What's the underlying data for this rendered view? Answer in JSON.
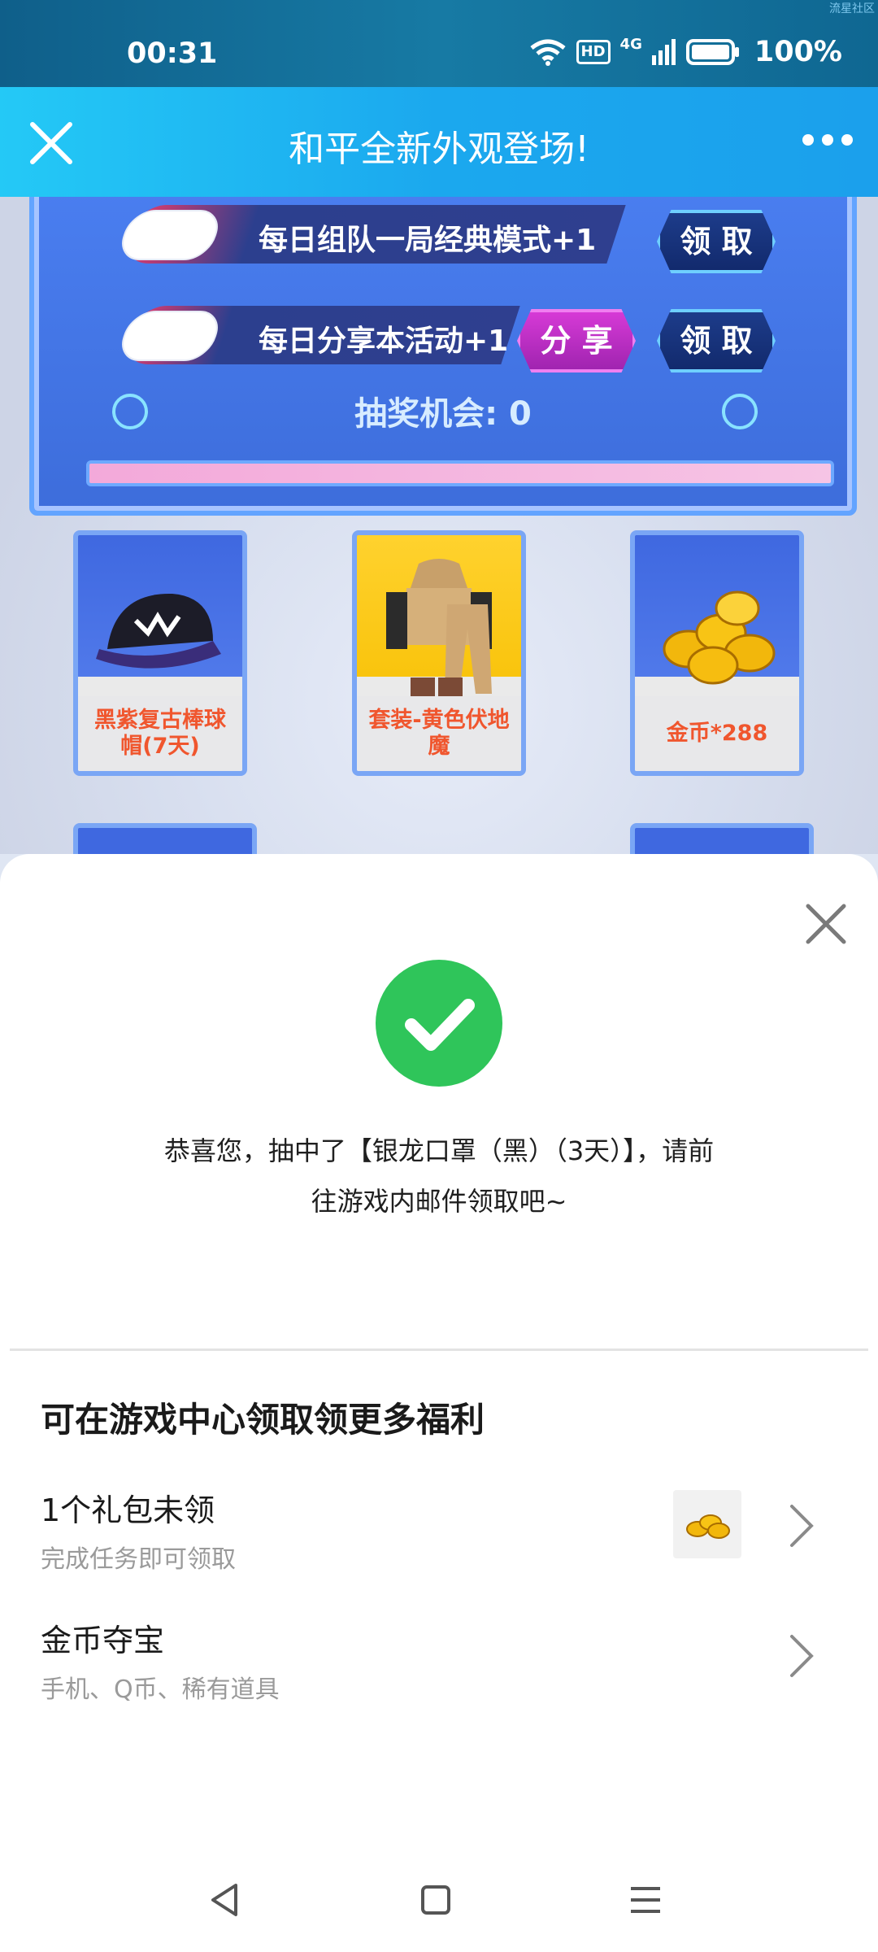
{
  "status_bar": {
    "time": "00:31",
    "network": "4G",
    "hd_badge": "HD",
    "battery": "100%",
    "watermark": "流星社区"
  },
  "header": {
    "title": "和平全新外观登场!",
    "close_icon": "close-icon",
    "more_icon": "more-dots-icon"
  },
  "game_banner": {
    "tasks": [
      {
        "label": "每日组队一局经典模式+1",
        "claim": "领 取"
      },
      {
        "label": "每日分享本活动+1",
        "share": "分 享",
        "claim": "领 取"
      }
    ],
    "chances_label": "抽奖机会:",
    "chances_value": "0",
    "prizes": [
      {
        "label": "黑紫复古棒球帽(7天)",
        "icon": "baseball-cap-icon"
      },
      {
        "label": "套装-黄色伏地魔",
        "icon": "outfit-icon"
      },
      {
        "label": "金币*288",
        "icon": "gold-coins-icon"
      }
    ]
  },
  "result_sheet": {
    "close_icon": "close-icon",
    "success_icon": "check-circle-icon",
    "message_line1": "恭喜您，抽中了【银龙口罩（黑）（3天）】，请前",
    "message_line2": "往游戏内邮件领取吧~",
    "section_title": "可在游戏中心领取领更多福利",
    "rows": [
      {
        "title": "1个礼包未领",
        "subtitle": "完成任务即可领取",
        "thumb": "gold-coins-icon"
      },
      {
        "title": "金币夺宝",
        "subtitle": "手机、Q币、稀有道具"
      }
    ]
  },
  "nav_bar": {
    "back": "back-triangle-icon",
    "home": "home-square-icon",
    "menu": "menu-lines-icon"
  },
  "colors": {
    "header_blue": "#1ba8ee",
    "success_green": "#2fc55a",
    "prize_text": "#f0562e"
  }
}
